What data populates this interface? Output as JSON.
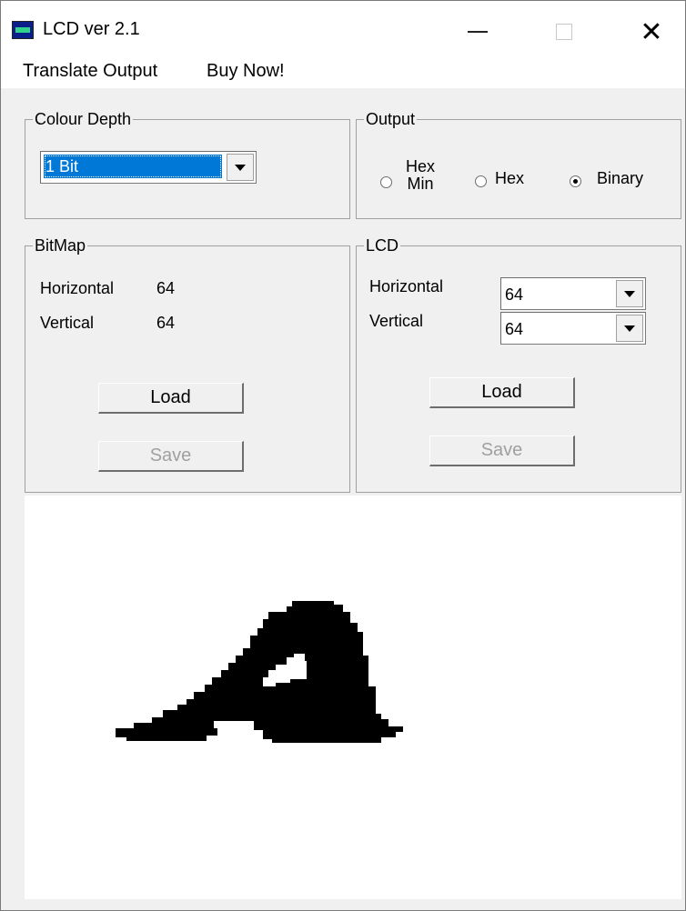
{
  "window": {
    "title": "LCD ver 2.1"
  },
  "menu": {
    "items": [
      "Translate Output",
      "Buy Now!"
    ]
  },
  "colour_depth": {
    "title": "Colour Depth",
    "selected": "1 Bit"
  },
  "output": {
    "title": "Output",
    "options": [
      {
        "label_line1": "Hex",
        "label_line2": "Min",
        "checked": false
      },
      {
        "label": "Hex",
        "checked": false
      },
      {
        "label": "Binary",
        "checked": true
      }
    ]
  },
  "bitmap": {
    "title": "BitMap",
    "horizontal_label": "Horizontal",
    "horizontal_value": "64",
    "vertical_label": "Vertical",
    "vertical_value": "64",
    "load_label": "Load",
    "save_label": "Save"
  },
  "lcd": {
    "title": "LCD",
    "horizontal_label": "Horizontal",
    "horizontal_value": "64",
    "vertical_label": "Vertical",
    "vertical_value": "64",
    "load_label": "Load",
    "save_label": "Save"
  },
  "colors": {
    "selection": "#0078d7",
    "glyph": "#000000",
    "canvas": "#ffffff"
  }
}
